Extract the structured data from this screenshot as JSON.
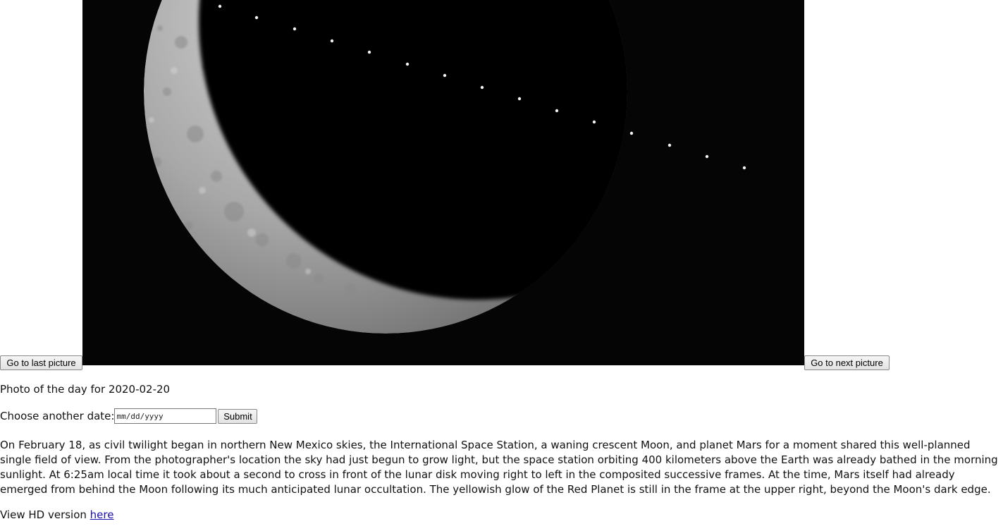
{
  "navigation": {
    "prev_label": "Go to last picture",
    "next_label": "Go to next picture"
  },
  "photo": {
    "subject": "International Space Station transit across crescent Moon",
    "colors": {
      "sky": "#050505",
      "moon_light": "#c9c9c9",
      "moon_dark": "#6c6c6c",
      "station": "#f2f2f2"
    }
  },
  "caption": "Photo of the day for 2020-02-20",
  "date_picker": {
    "label": "Choose another date:",
    "placeholder": "mm/dd/yyyy",
    "value": "",
    "submit_label": "Submit"
  },
  "description": "On February 18, as civil twilight began in northern New Mexico skies, the International Space Station, a waning crescent Moon, and planet Mars for a moment shared this well-planned single field of view. From the photographer's location the sky had just begun to grow light, but the space station orbiting 400 kilometers above the Earth was already bathed in the morning sunlight. At 6:25am local time it took about a second to cross in front of the lunar disk moving right to left in the composited successive frames. At the time, Mars itself had already emerged from behind the Moon following its much anticipated lunar occultation. The yellowish glow of the Red Planet is still in the frame at the upper right, beyond the Moon's dark edge.",
  "hd_link": {
    "prefix": "View HD version ",
    "link_text": "here"
  }
}
